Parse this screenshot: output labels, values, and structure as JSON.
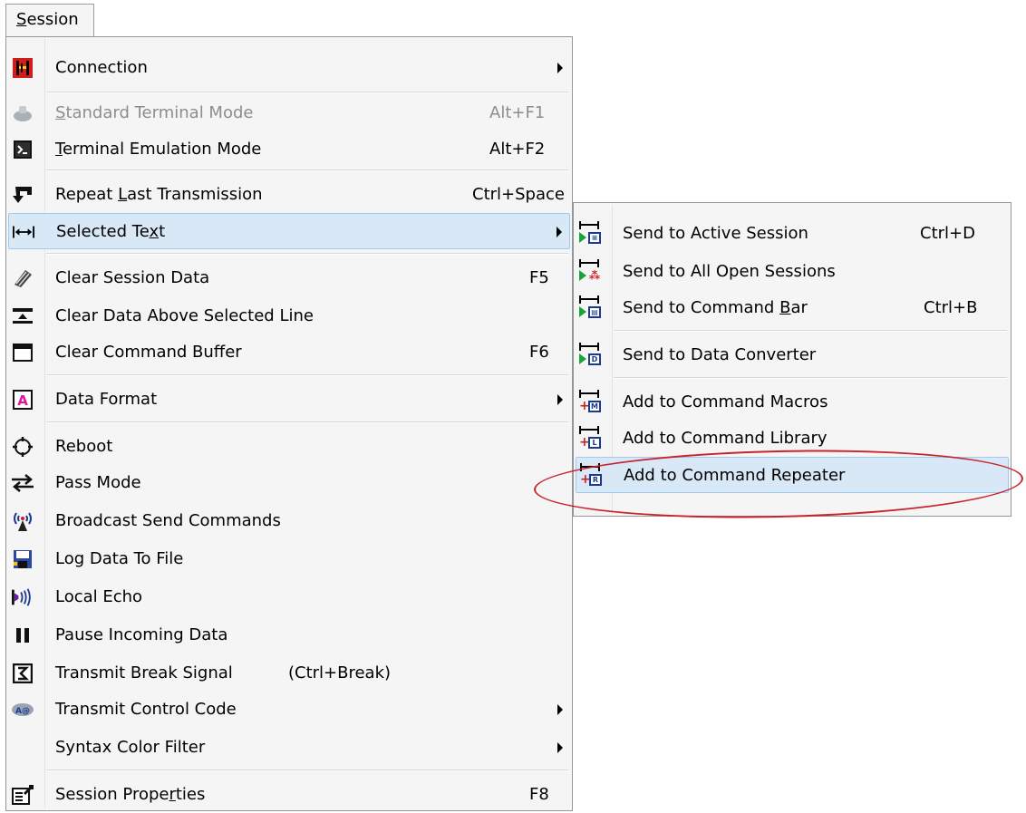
{
  "menubar": {
    "label_prefix": "",
    "label_access": "S",
    "label_rest": "ession"
  },
  "session_menu": {
    "items": [
      {
        "pre": "Connection",
        "acc": "",
        "post": "",
        "shortcut": "",
        "submenu": true
      },
      {
        "pre": "",
        "acc": "S",
        "post": "tandard Terminal Mode",
        "shortcut": "Alt+F1",
        "disabled": true
      },
      {
        "pre": "",
        "acc": "T",
        "post": "erminal Emulation Mode",
        "shortcut": "Alt+F2"
      },
      {
        "pre": "Repeat ",
        "acc": "L",
        "post": "ast Transmission",
        "shortcut": "Ctrl+Space"
      },
      {
        "pre": "Selected Te",
        "acc": "x",
        "post": "t",
        "shortcut": "",
        "submenu": true,
        "highlighted": true
      },
      {
        "pre": "Clear Session Data",
        "acc": "",
        "post": "",
        "shortcut": "F5"
      },
      {
        "pre": "Clear Data Above Selected Line",
        "acc": "",
        "post": "",
        "shortcut": ""
      },
      {
        "pre": "Clear Command Buffer",
        "acc": "",
        "post": "",
        "shortcut": "F6"
      },
      {
        "pre": "Data Format",
        "acc": "",
        "post": "",
        "shortcut": "",
        "submenu": true
      },
      {
        "pre": "Reboot",
        "acc": "",
        "post": "",
        "shortcut": ""
      },
      {
        "pre": "Pass Mode",
        "acc": "",
        "post": "",
        "shortcut": ""
      },
      {
        "pre": "Broadcast Send Commands",
        "acc": "",
        "post": "",
        "shortcut": ""
      },
      {
        "pre": "Log Data To File",
        "acc": "",
        "post": "",
        "shortcut": ""
      },
      {
        "pre": "Local Echo",
        "acc": "",
        "post": "",
        "shortcut": ""
      },
      {
        "pre": "Pause Incoming Data",
        "acc": "",
        "post": "",
        "shortcut": ""
      },
      {
        "pre": "Transmit Break Signal",
        "acc": "",
        "post": "",
        "shortcut": "(Ctrl+Break)"
      },
      {
        "pre": "Transmit Control Code",
        "acc": "",
        "post": "",
        "shortcut": "",
        "submenu": true
      },
      {
        "pre": "Syntax Color Filter",
        "acc": "",
        "post": "",
        "shortcut": "",
        "submenu": true
      },
      {
        "pre": "Session Prope",
        "acc": "r",
        "post": "ties",
        "shortcut": "F8"
      }
    ]
  },
  "selected_text_submenu": {
    "items": [
      {
        "pre": "Send to Active Session",
        "acc": "",
        "post": "",
        "shortcut": "Ctrl+D",
        "box": ""
      },
      {
        "pre": "Send to All Open Sessions",
        "acc": "",
        "post": "",
        "shortcut": "",
        "box": ""
      },
      {
        "pre": "Send to Command ",
        "acc": "B",
        "post": "ar",
        "shortcut": "Ctrl+B",
        "box": ""
      },
      {
        "pre": "Send to Data Converter",
        "acc": "",
        "post": "",
        "shortcut": "",
        "box": "D"
      },
      {
        "pre": "Add to Command Macros",
        "acc": "",
        "post": "",
        "shortcut": "",
        "box": "M"
      },
      {
        "pre": "Add to Command Library",
        "acc": "",
        "post": "",
        "shortcut": "",
        "box": "L"
      },
      {
        "pre": "Add to Command Repeater",
        "acc": "",
        "post": "",
        "shortcut": "",
        "box": "R",
        "highlighted": true
      }
    ]
  },
  "colors": {
    "menu_bg": "#f5f5f5",
    "highlight_bg": "#d8e8f7",
    "highlight_border": "#9ccbf2",
    "annotation": "#c8232c"
  }
}
